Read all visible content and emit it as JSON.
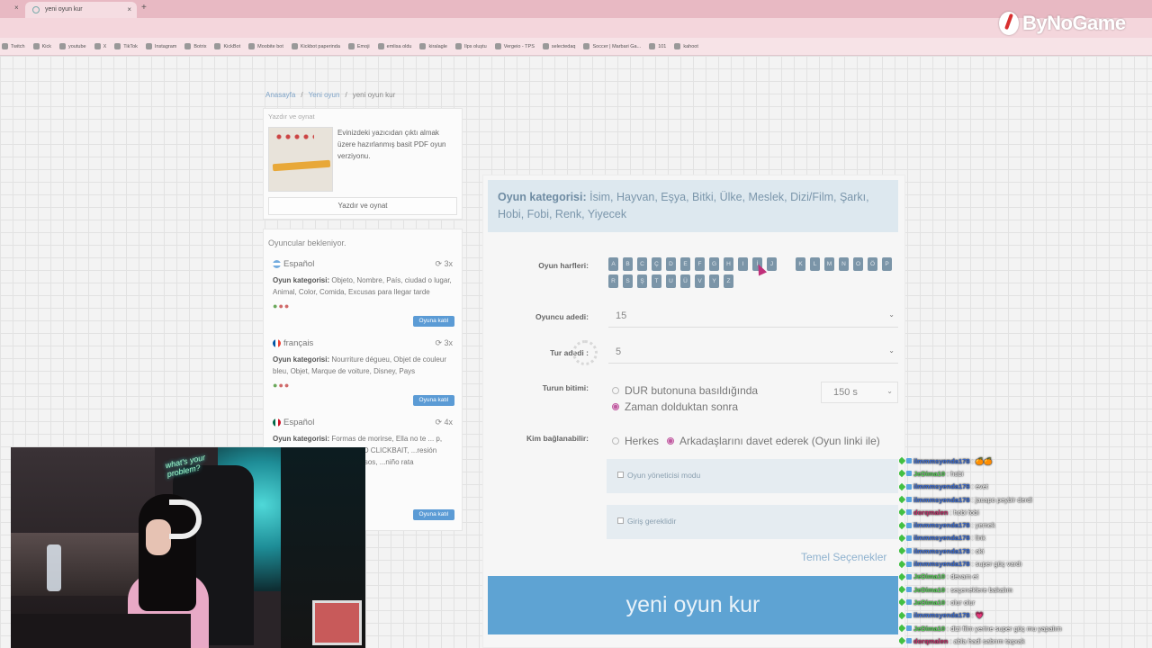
{
  "browser": {
    "tab_title": "yeni oyun kur",
    "new_tab_symbol": "+",
    "close_symbol": "×",
    "bookmarks": [
      "Twitch",
      "Kick",
      "youtube",
      "X",
      "TikTok",
      "Instagram",
      "Botrix",
      "KickBot",
      "Moobite bot",
      "Kickbot paperinda",
      "Emoji",
      "emlisa oldu",
      "kiralagle",
      "Ilps oluştu",
      "Vergeio - TPS",
      "selectedaq",
      "Soccer | Marbari Ga...",
      "101",
      "kahoot"
    ]
  },
  "brand": {
    "name": "ByNoGame"
  },
  "breadcrumb": {
    "home": "Anasayfa",
    "section": "Yeni oyun",
    "current": "yeni oyun kur"
  },
  "print_card": {
    "header": "Yazdır ve oynat",
    "description": "Evinizdeki yazıcıdan çıktı almak üzere hazırlanmış basit PDF oyun verziyonu.",
    "button": "Yazdır ve oynat"
  },
  "players_card": {
    "header": "Oyuncular bekleniyor.",
    "category_label": "Oyun kategorisi:",
    "join_label": "Oyuna katıl",
    "items": [
      {
        "language": "Español",
        "rounds": "3x",
        "categories": "Objeto, Nombre, País, ciudad o lugar, Animal, Color, Comida, Excusas para llegar tarde"
      },
      {
        "language": "français",
        "rounds": "3x",
        "categories": "Nourriture dégueu, Objet de couleur bleu, Objet, Marque de voiture, Disney, Pays"
      },
      {
        "language": "Español",
        "rounds": "4x",
        "categories": "Formas de morirse, Ella no te ... p, Videojuegos, me ...DE VIDEO CLICKBAIT, ...resión coreana / ...craft, típico de rusos, ...niño rata"
      }
    ]
  },
  "form": {
    "category_label": "Oyun kategorisi:",
    "category_value": "İsim, Hayvan, Eşya, Bitki, Ülke, Meslek, Dizi/Film, Şarkı, Hobi, Fobi, Renk, Yiyecek",
    "letters_label": "Oyun harfleri:",
    "letters": [
      "A",
      "B",
      "C",
      "Ç",
      "D",
      "E",
      "F",
      "G",
      "H",
      "I",
      "İ",
      "J",
      "K",
      "L",
      "M",
      "N",
      "O",
      "Ö",
      "P",
      "R",
      "S",
      "Ş",
      "T",
      "U",
      "Ü",
      "V",
      "Y",
      "Z"
    ],
    "player_count_label": "Oyuncu adedi:",
    "player_count_value": "15",
    "round_count_label": "Tur adedi :",
    "round_count_value": "5",
    "round_end_label": "Turun bitimi:",
    "round_end_options": [
      "DUR butonuna basıldığında",
      "Zaman dolduktan sonra"
    ],
    "round_end_selected": "Zaman dolduktan sonra",
    "timer_value": "150 s",
    "who_can_join_label": "Kim bağlanabilir:",
    "who_can_join_options": [
      "Herkes",
      "Arkadaşlarını davet ederek (Oyun linki ile)"
    ],
    "admin_mode_label": "Oyun yöneticisi modu",
    "login_required_label": "Giriş gereklidir",
    "basic_options_link": "Temel Seçenekler",
    "submit_label": "yeni oyun kur",
    "chevron": "⌄"
  },
  "webcam": {
    "neon_text": "what's your problem?"
  },
  "chat": {
    "messages": [
      {
        "user": "ilmmmsyenda178",
        "text": ": 🍊🍊",
        "color": "#3c6fd9"
      },
      {
        "user": "JeDima10",
        "text": ": hobi",
        "color": "#5cd65c"
      },
      {
        "user": "ilmmmsyenda178",
        "text": ": evet",
        "color": "#3c6fd9"
      },
      {
        "user": "ilmmmsyenda178",
        "text": ": jacapo peybir derdi",
        "color": "#3c6fd9"
      },
      {
        "user": "dorqmalen",
        "text": ": hobi fobi",
        "color": "#c0306a"
      },
      {
        "user": "ilmmmsyenda178",
        "text": ": yemek",
        "color": "#3c6fd9"
      },
      {
        "user": "ilmmmsyenda178",
        "text": ": link",
        "color": "#3c6fd9"
      },
      {
        "user": "ilmmmsyenda178",
        "text": ": oki",
        "color": "#3c6fd9"
      },
      {
        "user": "ilmmmsyenda178",
        "text": ": super güç vardı",
        "color": "#3c6fd9"
      },
      {
        "user": "JeDima10",
        "text": ": devam et",
        "color": "#5cd65c"
      },
      {
        "user": "JeDima10",
        "text": ": seçeneklere bakalım",
        "color": "#5cd65c"
      },
      {
        "user": "JeDima10",
        "text": ": olur olur",
        "color": "#5cd65c"
      },
      {
        "user": "ilmmmsyenda178",
        "text": ": 💗",
        "color": "#3c6fd9"
      },
      {
        "user": "JeDima10",
        "text": ": dizi film yerine super güç mu yapalım",
        "color": "#5cd65c"
      },
      {
        "user": "dorqmalen",
        "text": ": abla hadi sabrım taşxak",
        "color": "#c0306a"
      }
    ]
  }
}
